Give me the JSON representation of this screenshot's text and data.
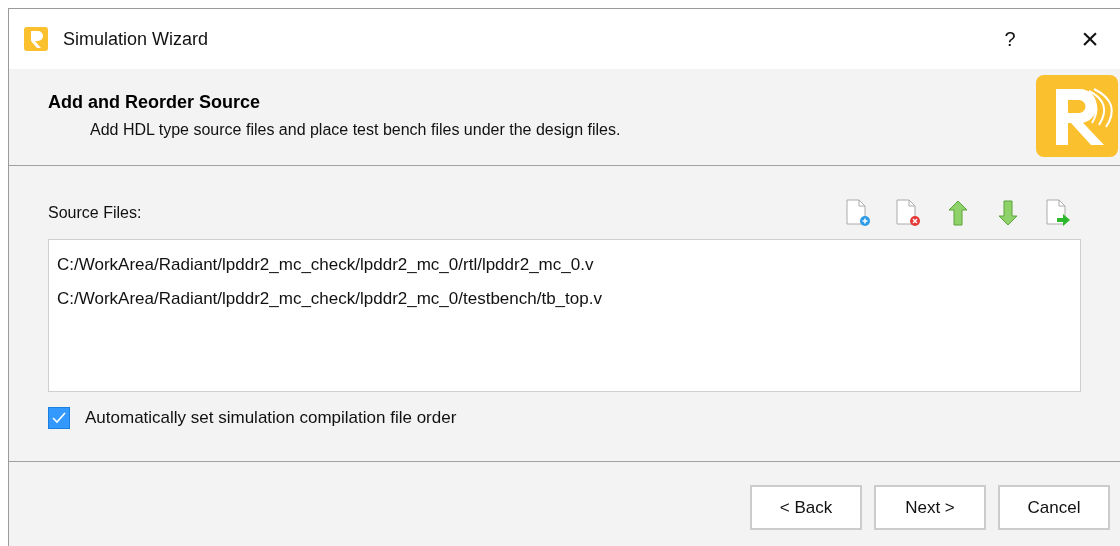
{
  "window": {
    "title": "Simulation Wizard",
    "help": "?",
    "close": "×"
  },
  "header": {
    "title": "Add and Reorder Source",
    "subtitle": "Add HDL type source files and place test bench files under the design files."
  },
  "source_files": {
    "label": "Source Files:",
    "files": [
      {
        "path": "C:/WorkArea/Radiant/lpddr2_mc_check/lpddr2_mc_0/rtl/lpddr2_mc_0.v",
        "selected": false
      },
      {
        "path": "C:/WorkArea/Radiant/lpddr2_mc_check/lpddr2_mc_0/testbench/tb_top.v",
        "selected": false
      }
    ]
  },
  "auto_order": {
    "label": "Automatically set simulation compilation file order",
    "checked": true
  },
  "buttons": [
    {
      "label": "< Back"
    },
    {
      "label": "Next >"
    },
    {
      "label": "Cancel"
    }
  ]
}
